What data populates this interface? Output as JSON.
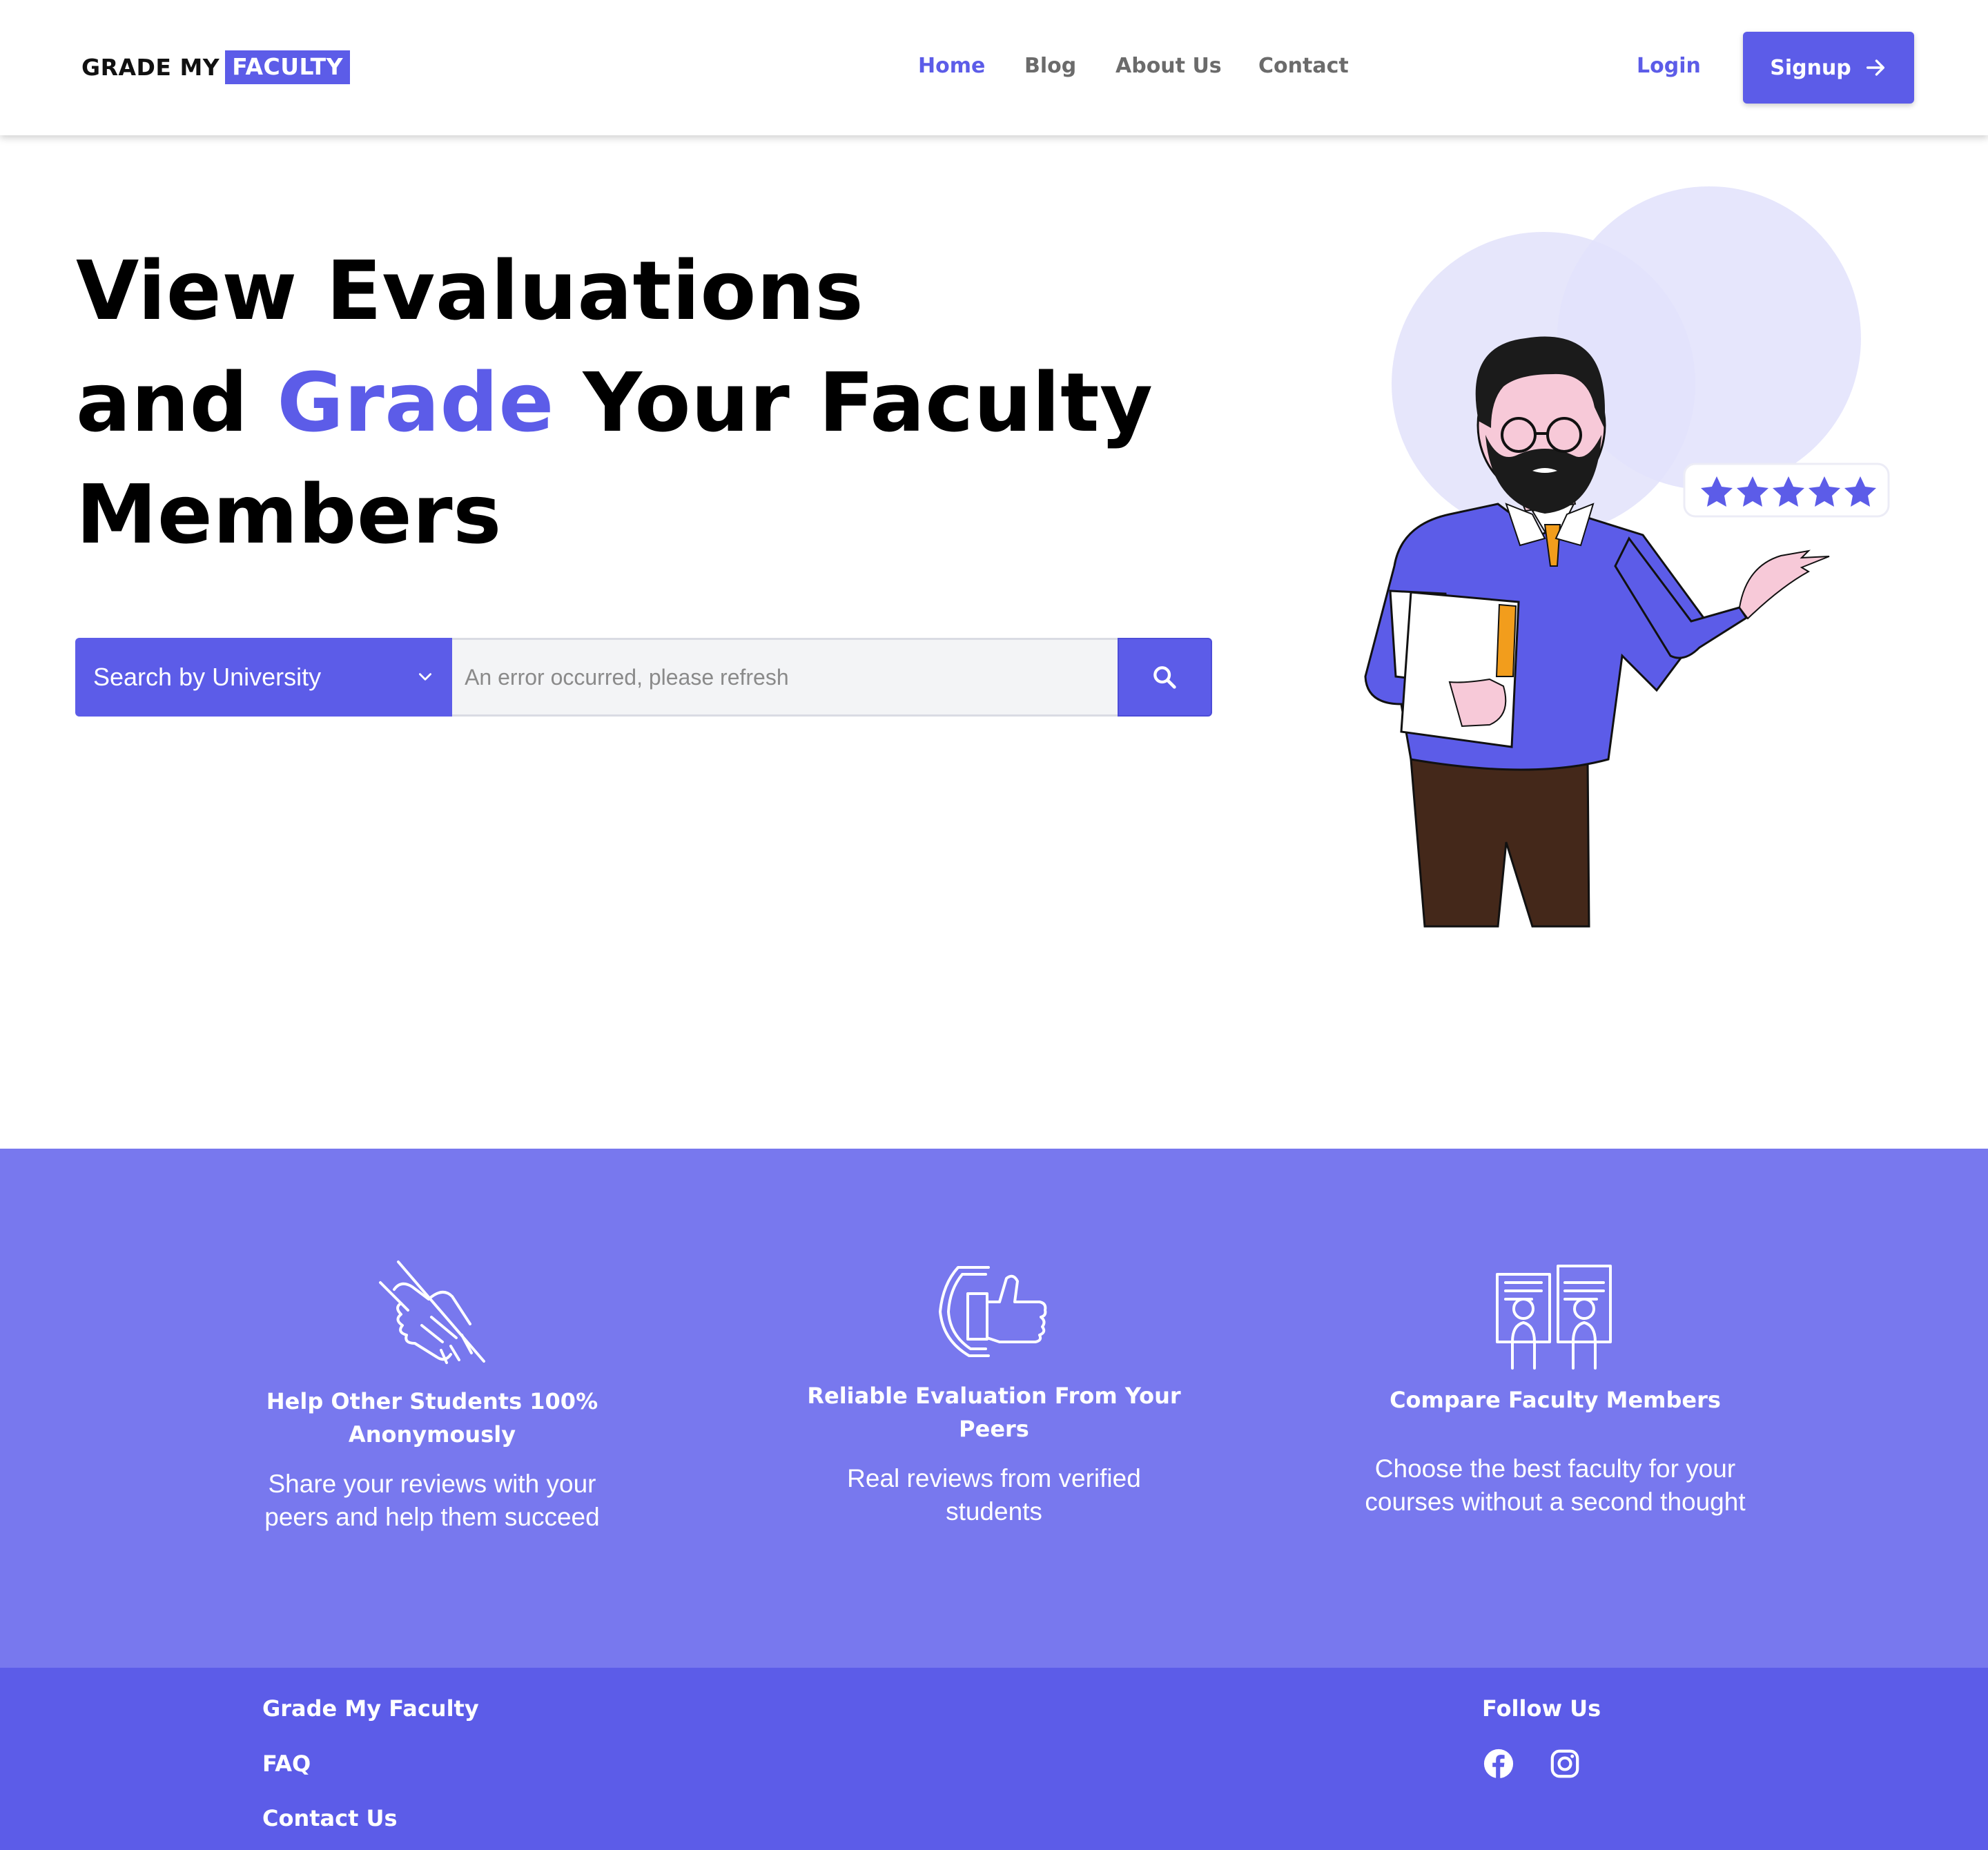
{
  "header": {
    "logo": {
      "part1": "GRADE MY",
      "part2": "FACULTY"
    },
    "nav": [
      {
        "label": "Home",
        "active": true
      },
      {
        "label": "Blog",
        "active": false
      },
      {
        "label": "About Us",
        "active": false
      },
      {
        "label": "Contact",
        "active": false
      }
    ],
    "login_label": "Login",
    "signup_label": "Signup"
  },
  "hero": {
    "line1": "View Evaluations",
    "line2_pre": "and ",
    "line2_accent": "Grade",
    "line2_post": " Your Faculty",
    "line3": "Members",
    "rating_stars": 5
  },
  "search": {
    "select_label": "Search by University",
    "input_placeholder": "An error occurred, please refresh",
    "input_value": ""
  },
  "features": [
    {
      "icon": "handshake-icon",
      "title": "Help Other Students 100% Anonymously",
      "text": "Share your reviews with your peers and help them succeed"
    },
    {
      "icon": "thumbs-up-shield-icon",
      "title": "Reliable Evaluation From Your Peers",
      "text": "Real reviews from verified students"
    },
    {
      "icon": "compare-profiles-icon",
      "title": "Compare Faculty Members",
      "text": "Choose the best faculty for your courses without a second thought"
    }
  ],
  "footer": {
    "links": [
      "Grade My Faculty",
      "FAQ",
      "Contact Us"
    ],
    "follow_label": "Follow Us",
    "social": [
      "facebook-icon",
      "instagram-icon"
    ]
  },
  "colors": {
    "accent": "#5c5ce8",
    "features_bg": "#7878ee",
    "footer_bg": "#5c5ce8",
    "nav_text": "#6b6b6b"
  }
}
